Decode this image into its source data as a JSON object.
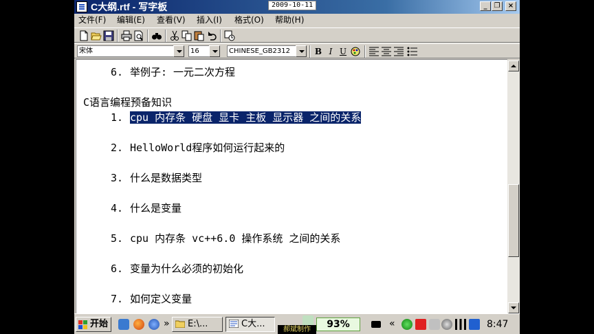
{
  "window": {
    "title": "C大纲.rtf - 写字板",
    "date_overlay": "2009-10-11",
    "controls": {
      "minimize": "_",
      "restore": "❐",
      "close": "×"
    }
  },
  "menu": [
    "文件(F)",
    "编辑(E)",
    "查看(V)",
    "插入(I)",
    "格式(O)",
    "帮助(H)"
  ],
  "toolbar": {
    "buttons": [
      "new-icon",
      "open-icon",
      "save-icon",
      "print-icon",
      "print-preview-icon",
      "find-icon",
      "cut-icon",
      "copy-icon",
      "paste-icon",
      "undo-icon",
      "insert-datetime-icon"
    ]
  },
  "format_bar": {
    "font": "宋体",
    "size": "16",
    "script": "CHINESE_GB2312",
    "bold": "B",
    "italic": "I",
    "underline": "U"
  },
  "document": {
    "lines": [
      {
        "num": "6.",
        "text": "举例子: 一元二次方程"
      },
      {
        "num": "",
        "text": "C语言编程预备知识"
      },
      {
        "num": "1.",
        "text": "cpu 内存条 硬盘 显卡 主板 显示器 之间的关系"
      },
      {
        "num": "2.",
        "text": "HelloWorld程序如何运行起来的"
      },
      {
        "num": "3.",
        "text": "什么是数据类型"
      },
      {
        "num": "4.",
        "text": "什么是变量"
      },
      {
        "num": "5.",
        "text": "cpu 内存条 vc++6.0 操作系统 之间的关系"
      },
      {
        "num": "6.",
        "text": "变量为什么必须的初始化"
      },
      {
        "num": "7.",
        "text": "如何定义变量"
      }
    ]
  },
  "taskbar": {
    "start": "开始",
    "chevron": "»",
    "tasks": [
      "E:\\...",
      "C大..."
    ],
    "battery": "93%",
    "battery_label": "郝斌制作",
    "tray_chevron": "«",
    "clock": "8:47"
  }
}
